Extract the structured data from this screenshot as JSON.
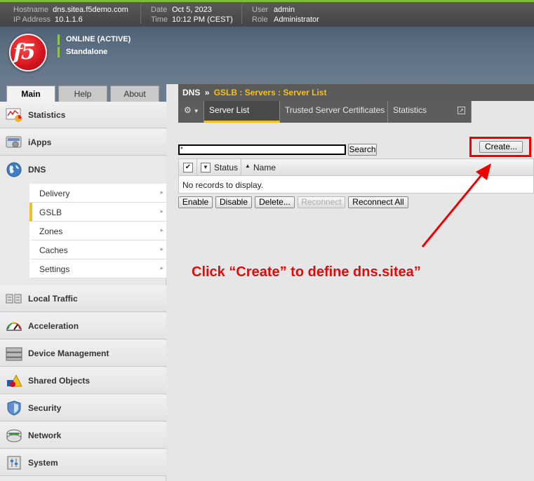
{
  "statusbar": {
    "hostname_label": "Hostname",
    "hostname": "dns.sitea.f5demo.com",
    "ip_label": "IP Address",
    "ip": "10.1.1.6",
    "date_label": "Date",
    "date": "Oct 5, 2023",
    "time_label": "Time",
    "time": "10:12 PM (CEST)",
    "user_label": "User",
    "user": "admin",
    "role_label": "Role",
    "role": "Administrator"
  },
  "banner": {
    "logo_text": "f5",
    "status1": "ONLINE (ACTIVE)",
    "status2": "Standalone"
  },
  "nav_tabs": {
    "main": "Main",
    "help": "Help",
    "about": "About"
  },
  "sidebar": {
    "statistics": "Statistics",
    "iapps": "iApps",
    "dns": "DNS",
    "dns_sub": [
      "Delivery",
      "GSLB",
      "Zones",
      "Caches",
      "Settings"
    ],
    "local_traffic": "Local Traffic",
    "acceleration": "Acceleration",
    "device_management": "Device Management",
    "shared_objects": "Shared Objects",
    "security": "Security",
    "network": "Network",
    "system": "System"
  },
  "breadcrumb": {
    "root": "DNS",
    "sep": "»",
    "path": "GSLB : Servers : Server List"
  },
  "subtabs": {
    "server_list": "Server List",
    "trusted_certs": "Trusted Server Certificates",
    "statistics": "Statistics"
  },
  "search": {
    "value": "*",
    "button": "Search"
  },
  "create_button": "Create...",
  "table": {
    "col_status": "Status",
    "col_name": "Name",
    "empty": "No records to display."
  },
  "actions": {
    "enable": "Enable",
    "disable": "Disable",
    "delete": "Delete...",
    "reconnect": "Reconnect",
    "reconnect_all": "Reconnect All"
  },
  "annotation": "Click “Create” to define dns.sitea”"
}
